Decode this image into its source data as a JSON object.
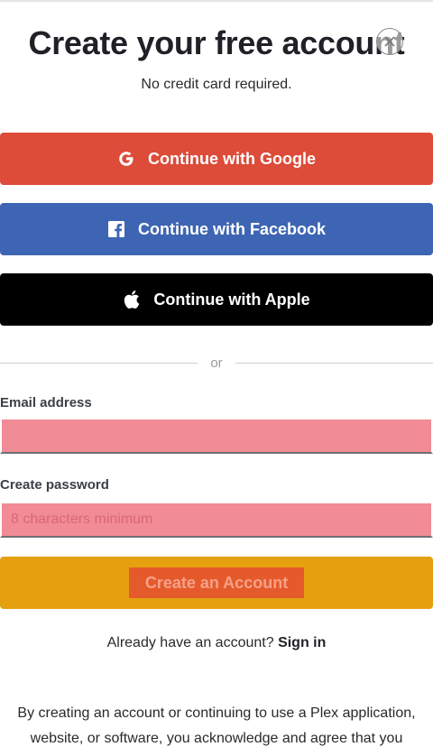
{
  "header": {
    "title": "Create your free account",
    "subtitle": "No credit card required."
  },
  "social": {
    "google_label": "Continue with Google",
    "facebook_label": "Continue with Facebook",
    "apple_label": "Continue with Apple",
    "google_color": "#dd4b39",
    "facebook_color": "#3e65b3",
    "apple_color": "#000000"
  },
  "divider": {
    "text": "or"
  },
  "form": {
    "email_label": "Email address",
    "email_value": "",
    "email_placeholder": "",
    "password_label": "Create password",
    "password_value": "",
    "password_placeholder": "8 characters minimum",
    "submit_label": "Create an Account"
  },
  "signin": {
    "prompt": "Already have an account?",
    "link_label": "Sign in"
  },
  "legal": {
    "line1": "By creating an account or continuing to use a Plex application,",
    "line2": "website, or software, you acknowledge and agree that you"
  },
  "icons": {
    "close": "close-icon",
    "google": "google-g-icon",
    "facebook": "facebook-f-icon",
    "apple": "apple-icon"
  },
  "colors": {
    "field_bg": "#f18b96",
    "submit_wrap": "#e4a00f",
    "submit_btn": "#e55a2a"
  }
}
